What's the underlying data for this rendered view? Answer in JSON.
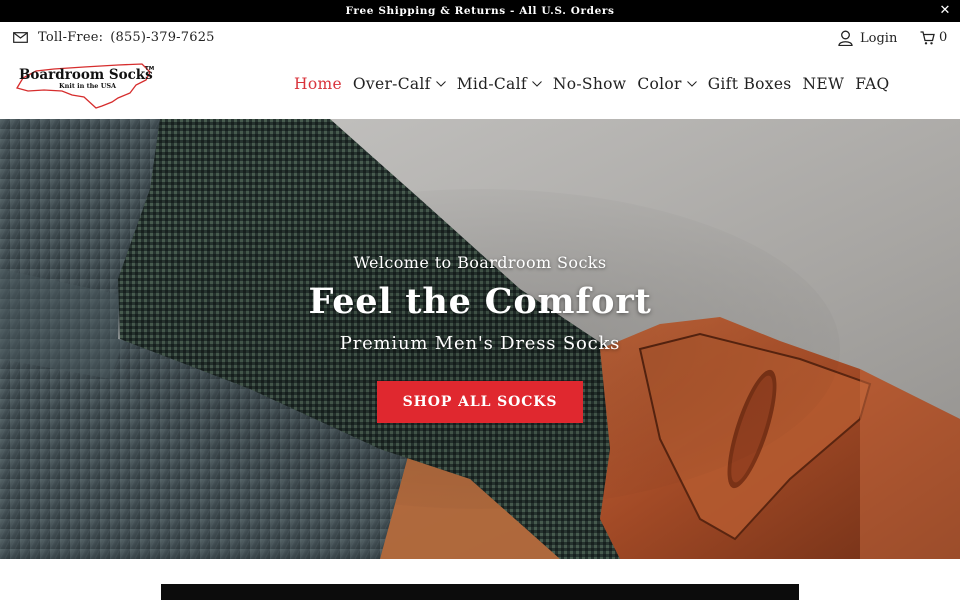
{
  "announcement": {
    "text": "Free Shipping & Returns - All U.S. Orders",
    "close_glyph": "✕"
  },
  "utility": {
    "phone_label": "Toll-Free:",
    "phone_number": "(855)-379-7625",
    "phone_icon": "envelope-icon",
    "login_label": "Login",
    "login_icon": "user-icon",
    "cart_count": "0",
    "cart_icon": "cart-icon"
  },
  "logo": {
    "brand": "Boardroom Socks",
    "tagline": "Knit in the USA",
    "trademark": "TM"
  },
  "nav": {
    "items": [
      {
        "label": "Home",
        "active": true
      },
      {
        "label": "Over-Calf",
        "dropdown": true
      },
      {
        "label": "Mid-Calf",
        "dropdown": true
      },
      {
        "label": "No-Show"
      },
      {
        "label": "Color",
        "dropdown": true
      },
      {
        "label": "Gift Boxes"
      },
      {
        "label": "NEW"
      },
      {
        "label": "FAQ"
      }
    ]
  },
  "hero": {
    "pre_title": "Welcome to Boardroom Socks",
    "title": "Feel the Comfort",
    "subtitle": "Premium Men's Dress Socks",
    "cta": "SHOP ALL SOCKS"
  },
  "colors": {
    "accent": "#e0282f",
    "nav_active": "#d9343c",
    "announcement_bg": "#000000"
  }
}
